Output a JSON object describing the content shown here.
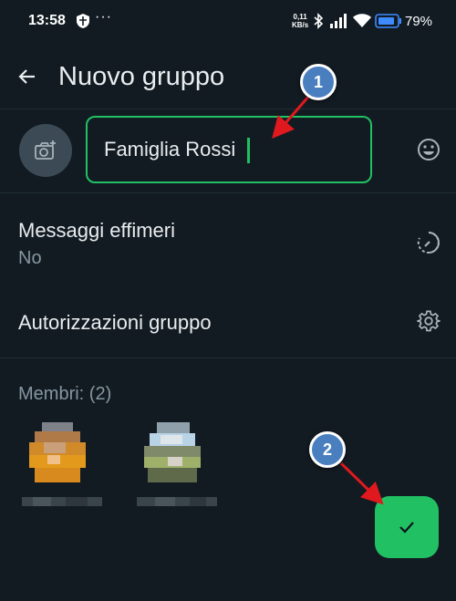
{
  "status_bar": {
    "time": "13:58",
    "dots": "···",
    "speed_value": "0,11",
    "speed_unit": "KB/s",
    "battery_percent": "79%"
  },
  "app_bar": {
    "title": "Nuovo gruppo"
  },
  "group_name": {
    "value": "Famiglia Rossi"
  },
  "settings": {
    "disappearing_title": "Messaggi effimeri",
    "disappearing_value": "No",
    "permissions_title": "Autorizzazioni gruppo"
  },
  "members": {
    "label": "Membri: (2)",
    "count": 2
  },
  "annotations": {
    "callout_1": "1",
    "callout_2": "2"
  },
  "colors": {
    "background": "#121b22",
    "accent": "#21c063",
    "callout": "#4a7fbf",
    "arrow": "#e0191e"
  },
  "icons": {
    "back": "arrow-left-icon",
    "photo": "camera-add-icon",
    "emoji": "emoji-icon",
    "timer": "timer-icon",
    "settings": "gear-icon",
    "confirm": "check-icon"
  }
}
